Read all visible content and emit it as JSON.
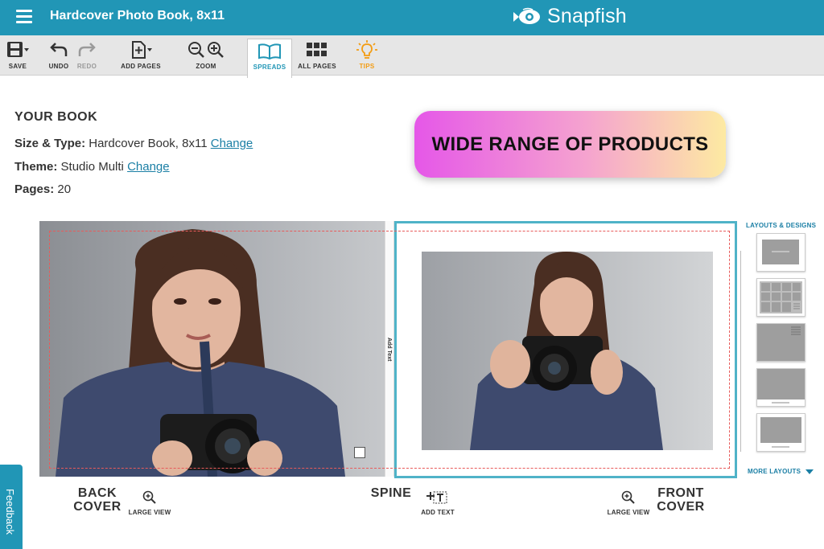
{
  "header": {
    "title": "Hardcover Photo Book, 8x11",
    "logo_text": "Snapfish",
    "color": "#2196b6"
  },
  "toolbar": {
    "save": "SAVE",
    "undo": "UNDO",
    "redo": "REDO",
    "add_pages": "ADD PAGES",
    "zoom": "ZOOM",
    "spreads": "SPREADS",
    "all_pages": "ALL PAGES",
    "tips": "TIPS"
  },
  "book": {
    "heading": "YOUR BOOK",
    "size_label": "Size & Type:",
    "size_value": "Hardcover Book, 8x11",
    "theme_label": "Theme:",
    "theme_value": "Studio Multi",
    "pages_label": "Pages:",
    "pages_value": "20",
    "change_link": "Change"
  },
  "promo": {
    "text": "WIDE RANGE OF PRODUCTS"
  },
  "spread": {
    "spine_text": "Add Text",
    "back_cover": "BACK\nCOVER",
    "spine": "SPINE",
    "front_cover": "FRONT\nCOVER",
    "large_view": "LARGE VIEW",
    "add_text": "ADD TEXT"
  },
  "layouts": {
    "title": "LAYOUTS & DESIGNS",
    "more": "MORE LAYOUTS"
  },
  "feedback": "Feedback"
}
